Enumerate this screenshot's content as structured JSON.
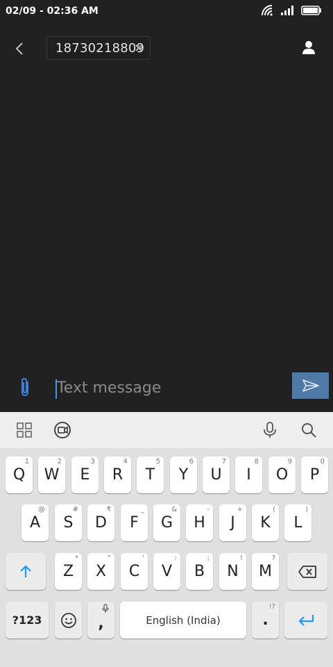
{
  "status_bar": {
    "time": "02/09 - 02:36 AM",
    "icons": [
      "wifi-icon",
      "signal-icon",
      "battery-icon"
    ]
  },
  "header": {
    "back_icon": "chevron-left-icon",
    "recipient": "18730218809",
    "remove_recipient_icon": "close-icon",
    "contact_icon": "person-icon"
  },
  "compose": {
    "attach_icon": "paperclip-icon",
    "placeholder": "Text message",
    "value": "",
    "send_icon": "send-icon"
  },
  "keyboard": {
    "toolbar": {
      "left": [
        "grid-icon",
        "sticker-icon"
      ],
      "right": [
        "microphone-icon",
        "search-icon"
      ]
    },
    "row1": [
      {
        "label": "Q",
        "hint": "1"
      },
      {
        "label": "W",
        "hint": "2"
      },
      {
        "label": "E",
        "hint": "3"
      },
      {
        "label": "R",
        "hint": "4"
      },
      {
        "label": "T",
        "hint": "5"
      },
      {
        "label": "Y",
        "hint": "6"
      },
      {
        "label": "U",
        "hint": "7"
      },
      {
        "label": "I",
        "hint": "8"
      },
      {
        "label": "O",
        "hint": "9"
      },
      {
        "label": "P",
        "hint": "0"
      }
    ],
    "row2": [
      {
        "label": "A",
        "hint": "@"
      },
      {
        "label": "S",
        "hint": "#"
      },
      {
        "label": "D",
        "hint": "₹"
      },
      {
        "label": "F",
        "hint": "_"
      },
      {
        "label": "G",
        "hint": "&"
      },
      {
        "label": "H",
        "hint": "-"
      },
      {
        "label": "J",
        "hint": "+"
      },
      {
        "label": "K",
        "hint": "("
      },
      {
        "label": "L",
        "hint": ")"
      }
    ],
    "row3": [
      {
        "label": "Z",
        "hint": "*"
      },
      {
        "label": "X",
        "hint": "\""
      },
      {
        "label": "C",
        "hint": "'"
      },
      {
        "label": "V",
        "hint": ":"
      },
      {
        "label": "B",
        "hint": ";"
      },
      {
        "label": "N",
        "hint": "!"
      },
      {
        "label": "M",
        "hint": "?"
      }
    ],
    "shift_icon": "shift-arrow-icon",
    "backspace_icon": "backspace-icon",
    "symbols_label": "?123",
    "emoji_icon": "emoji-icon",
    "comma_label": ",",
    "comma_hint_icon": "microphone-icon",
    "space_label": "English (India)",
    "period_label": ".",
    "period_hint": "!?",
    "enter_icon": "enter-arrow-icon"
  },
  "colors": {
    "background": "#212121",
    "send_button": "#4e7aa8",
    "accent": "#2196f3",
    "keyboard_bg": "#e0e0e0"
  }
}
